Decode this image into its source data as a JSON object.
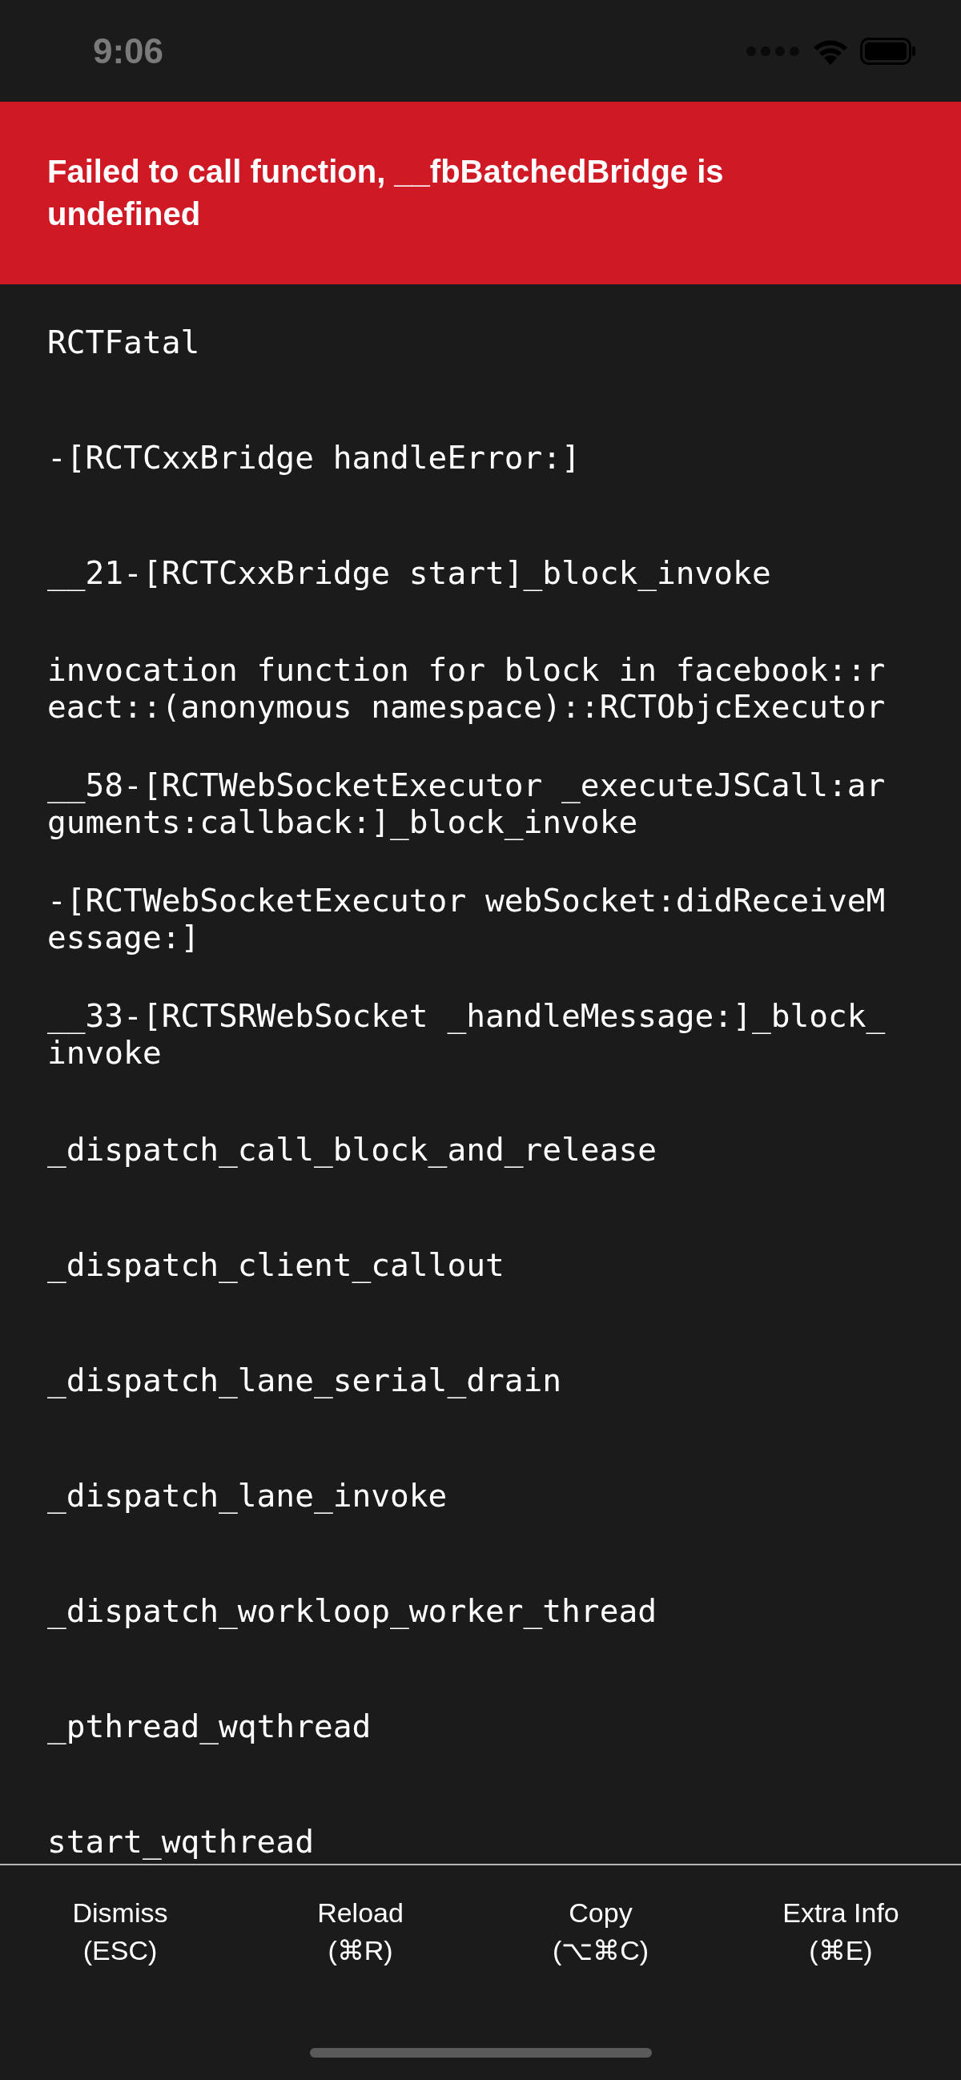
{
  "status_bar": {
    "time": "9:06"
  },
  "error": {
    "message": "Failed to call function, __fbBatchedBridge is undefined"
  },
  "stack": [
    "RCTFatal",
    "-[RCTCxxBridge handleError:]",
    "__21-[RCTCxxBridge start]_block_invoke",
    "invocation function for block in facebook::react::(anonymous namespace)::RCTObjcExecutor",
    "__58-[RCTWebSocketExecutor _executeJSCall:arguments:callback:]_block_invoke",
    "-[RCTWebSocketExecutor webSocket:didReceiveMessage:]",
    "__33-[RCTSRWebSocket _handleMessage:]_block_invoke",
    "_dispatch_call_block_and_release",
    "_dispatch_client_callout",
    "_dispatch_lane_serial_drain",
    "_dispatch_lane_invoke",
    "_dispatch_workloop_worker_thread",
    "_pthread_wqthread",
    "start_wqthread"
  ],
  "buttons": [
    {
      "label": "Dismiss",
      "shortcut": "(ESC)"
    },
    {
      "label": "Reload",
      "shortcut": "(⌘R)"
    },
    {
      "label": "Copy",
      "shortcut": "(⌥⌘C)"
    },
    {
      "label": "Extra Info",
      "shortcut": "(⌘E)"
    }
  ]
}
